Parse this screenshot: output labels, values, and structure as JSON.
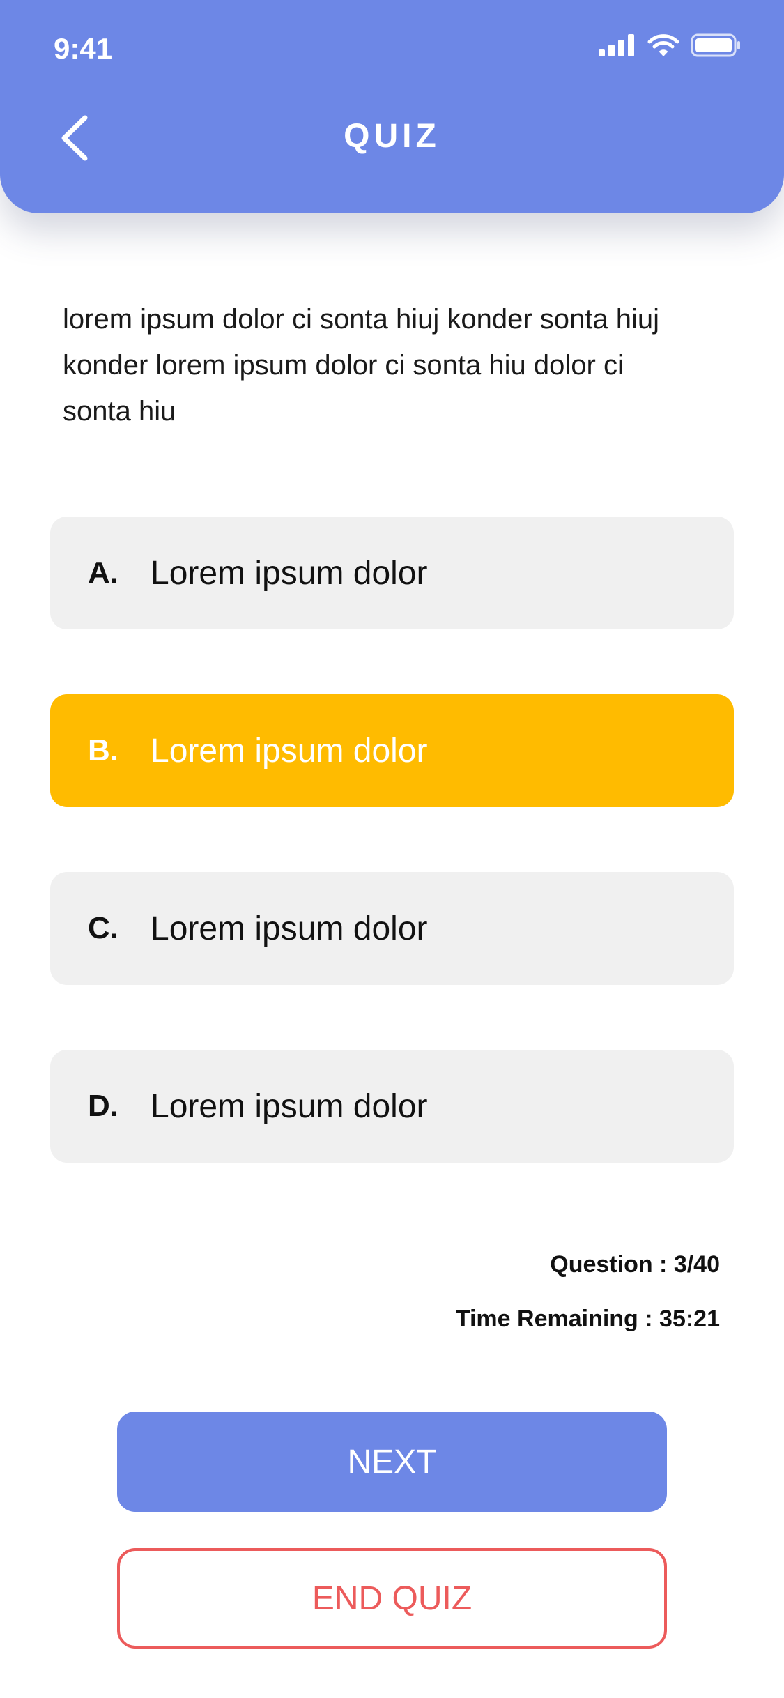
{
  "status_bar": {
    "time": "9:41",
    "icons": [
      "cellular-signal-icon",
      "wifi-icon",
      "battery-icon"
    ]
  },
  "header": {
    "back_icon": "chevron-left-icon",
    "title": "QUIZ",
    "background_color": "#6d87e6"
  },
  "question": {
    "text": "lorem ipsum dolor ci sonta hiuj konder  sonta hiuj konder lorem ipsum dolor ci sonta hiu dolor ci sonta hiu"
  },
  "options": [
    {
      "letter": "A.",
      "text": "Lorem ipsum dolor",
      "selected": false
    },
    {
      "letter": "B.",
      "text": "Lorem ipsum dolor",
      "selected": true
    },
    {
      "letter": "C.",
      "text": "Lorem ipsum dolor",
      "selected": false
    },
    {
      "letter": "D.",
      "text": "Lorem ipsum dolor",
      "selected": false
    }
  ],
  "progress": {
    "question_label": "Question : 3/40",
    "time_label": "Time Remaining : 35:21"
  },
  "actions": {
    "next_label": "NEXT",
    "end_label": "END QUIZ"
  },
  "colors": {
    "primary": "#6d87e6",
    "selected_option": "#ffbb00",
    "option_background": "#f0f0f0",
    "danger": "#ec5b5b"
  }
}
